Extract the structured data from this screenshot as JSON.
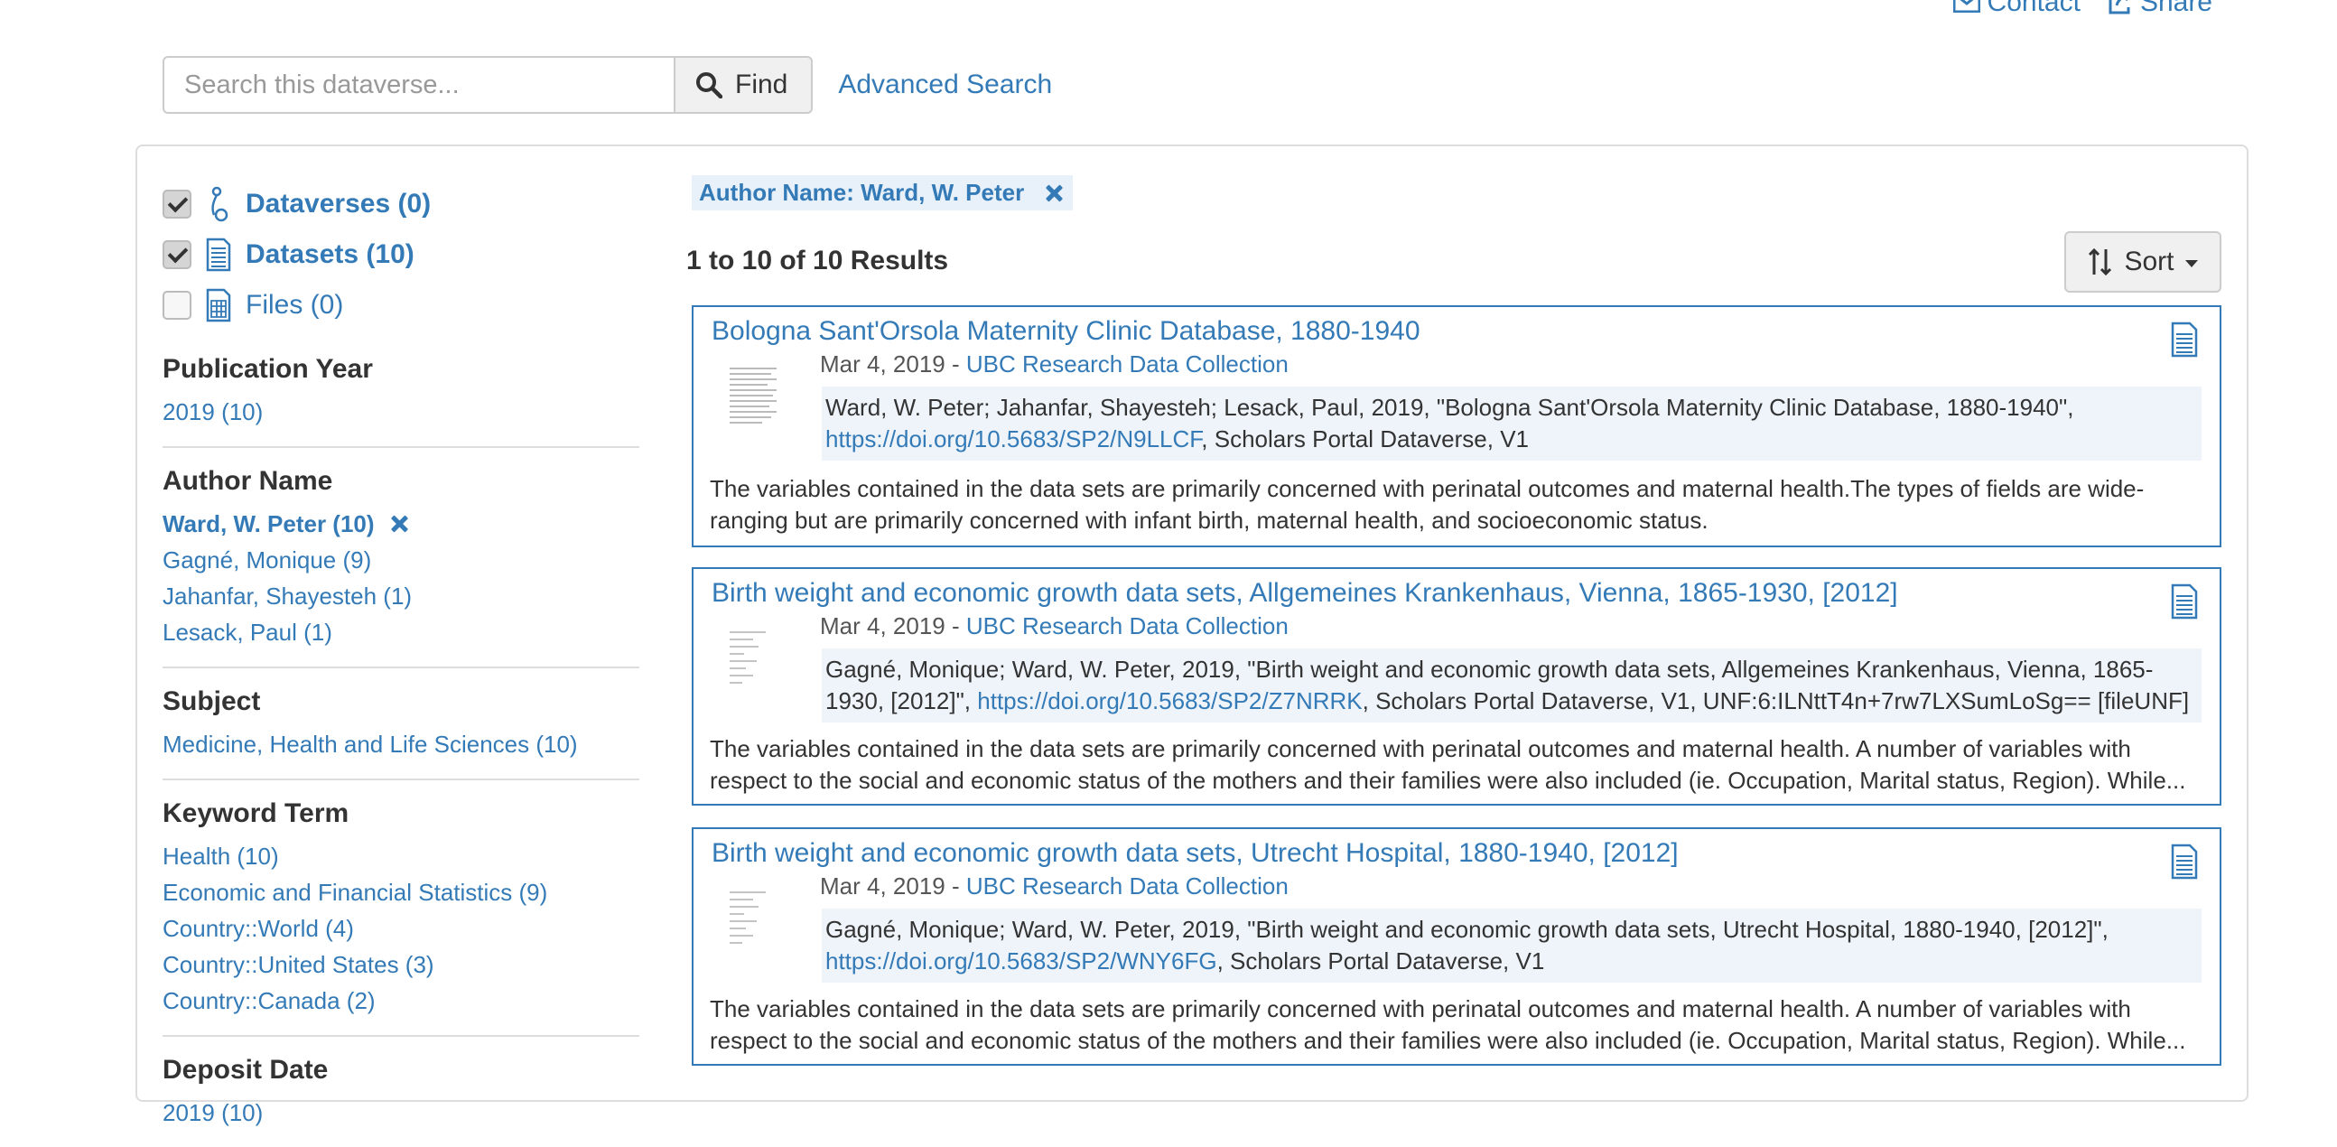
{
  "top_links": {
    "contact": "Contact",
    "share": "Share"
  },
  "search": {
    "placeholder": "Search this dataverse...",
    "find_label": "Find",
    "advanced_label": "Advanced Search"
  },
  "types": [
    {
      "label": "Dataverses (0)",
      "checked": true,
      "icon": "dataverse-icon"
    },
    {
      "label": "Datasets (10)",
      "checked": true,
      "icon": "dataset-icon"
    },
    {
      "label": "Files (0)",
      "checked": false,
      "icon": "file-icon"
    }
  ],
  "facets": {
    "publication_year": {
      "title": "Publication Year",
      "items": [
        "2019 (10)"
      ]
    },
    "author_name": {
      "title": "Author Name",
      "selected": "Ward, W. Peter (10)",
      "items": [
        "Gagné, Monique (9)",
        "Jahanfar, Shayesteh (1)",
        "Lesack, Paul (1)"
      ]
    },
    "subject": {
      "title": "Subject",
      "items": [
        "Medicine, Health and Life Sciences (10)"
      ]
    },
    "keyword_term": {
      "title": "Keyword Term",
      "items": [
        "Health (10)",
        "Economic and Financial Statistics (9)",
        "Country::World (4)",
        "Country::United States (3)",
        "Country::Canada (2)"
      ]
    },
    "deposit_date": {
      "title": "Deposit Date",
      "items": [
        "2019 (10)"
      ]
    }
  },
  "filter_chip": "Author Name: Ward, W. Peter",
  "results": {
    "count_text": "1 to 10 of 10 Results",
    "sort_label": "Sort"
  },
  "colors": {
    "link": "#337ab7",
    "citation_bg": "#eef4fa",
    "border": "#dddddd"
  },
  "cards": [
    {
      "title": "Bologna Sant'Orsola Maternity Clinic Database, 1880-1940",
      "date": "Mar 4, 2019",
      "separator": " - ",
      "collection": "UBC Research Data Collection",
      "citation_pre": "Ward, W. Peter; Jahanfar, Shayesteh; Lesack, Paul, 2019, \"Bologna Sant'Orsola Maternity Clinic Database, 1880-1940\", ",
      "doi": "https://doi.org/10.5683/SP2/N9LLCF",
      "citation_post": ", Scholars Portal Dataverse, V1",
      "description": "The variables contained in the data sets are primarily concerned with perinatal outcomes and maternal health.The types of fields are wide-ranging but are primarily concerned with infant birth, maternal health, and socioeconomic status."
    },
    {
      "title": "Birth weight and economic growth data sets, Allgemeines Krankenhaus, Vienna, 1865-1930, [2012]",
      "date": "Mar 4, 2019",
      "separator": " - ",
      "collection": "UBC Research Data Collection",
      "citation_pre": "Gagné, Monique; Ward, W. Peter, 2019, \"Birth weight and economic growth data sets, Allgemeines Krankenhaus, Vienna, 1865-1930, [2012]\", ",
      "doi": "https://doi.org/10.5683/SP2/Z7NRRK",
      "citation_post": ", Scholars Portal Dataverse, V1, UNF:6:ILNttT4n+7rw7LXSumLoSg== [fileUNF]",
      "description": "The variables contained in the data sets are primarily concerned with perinatal outcomes and maternal health. A number of variables with respect to the social and economic status of the mothers and their families were also included (ie. Occupation, Marital status, Region). While..."
    },
    {
      "title": "Birth weight and economic growth data sets, Utrecht Hospital, 1880-1940, [2012]",
      "date": "Mar 4, 2019",
      "separator": " - ",
      "collection": "UBC Research Data Collection",
      "citation_pre": "Gagné, Monique; Ward, W. Peter, 2019, \"Birth weight and economic growth data sets, Utrecht Hospital, 1880-1940, [2012]\", ",
      "doi": "https://doi.org/10.5683/SP2/WNY6FG",
      "citation_post": ", Scholars Portal Dataverse, V1",
      "description": "The variables contained in the data sets are primarily concerned with perinatal outcomes and maternal health. A number of variables with respect to the social and economic status of the mothers and their families were also included (ie. Occupation, Marital status, Region). While..."
    }
  ]
}
